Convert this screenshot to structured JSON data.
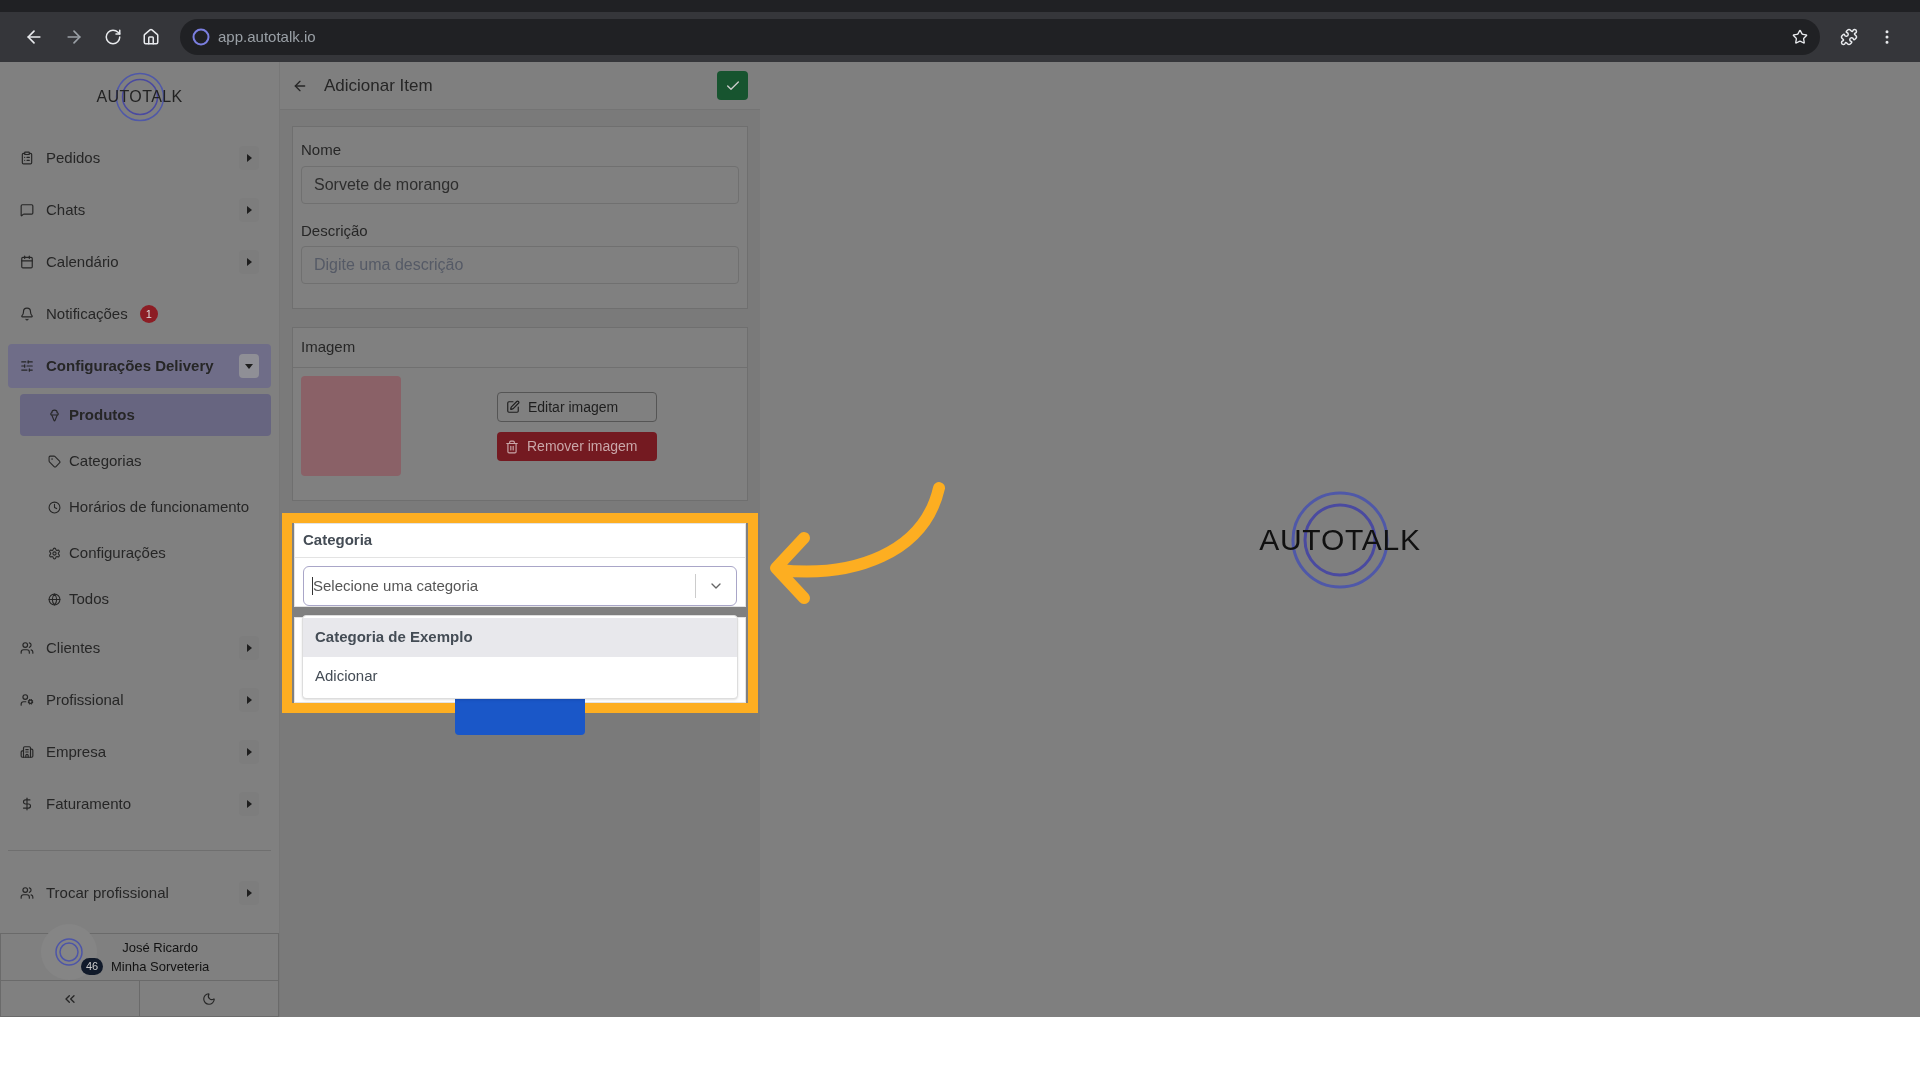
{
  "browser": {
    "url": "app.autotalk.io"
  },
  "sidebar": {
    "logo": "AUTOTALK",
    "items": [
      {
        "label": "Pedidos",
        "kind": "menu",
        "expanded": false
      },
      {
        "label": "Chats",
        "kind": "menu",
        "expanded": false
      },
      {
        "label": "Calendário",
        "kind": "menu",
        "expanded": false
      },
      {
        "label": "Notificações",
        "kind": "link",
        "badge": "1"
      },
      {
        "label": "Configurações Delivery",
        "kind": "menu",
        "expanded": true,
        "children": [
          {
            "label": "Produtos",
            "selected": true
          },
          {
            "label": "Categorias",
            "selected": false
          },
          {
            "label": "Horários de funcionamento",
            "selected": false
          },
          {
            "label": "Configurações",
            "selected": false
          },
          {
            "label": "Todos",
            "selected": false
          }
        ]
      },
      {
        "label": "Clientes",
        "kind": "menu",
        "expanded": false
      },
      {
        "label": "Profissional",
        "kind": "menu",
        "expanded": false
      },
      {
        "label": "Empresa",
        "kind": "menu",
        "expanded": false
      },
      {
        "label": "Faturamento",
        "kind": "menu",
        "expanded": false
      }
    ],
    "switch_item": {
      "label": "Trocar profissional"
    },
    "user": {
      "name": "José Ricardo",
      "company": "Minha Sorveteria",
      "badge": "46"
    }
  },
  "form": {
    "title": "Adicionar Item",
    "fields": [
      {
        "label": "Nome",
        "value": "Sorvete de morango"
      },
      {
        "label": "Descrição",
        "placeholder": "Digite uma descrição"
      }
    ],
    "image": {
      "title": "Imagem",
      "edit_button": "Editar imagem",
      "remove_button": "Remover imagem"
    },
    "category": {
      "title": "Categoria",
      "placeholder": "Selecione uma categoria",
      "options": [
        {
          "label": "Categoria de Exemplo",
          "selected": true
        },
        {
          "label": "Adicionar",
          "selected": false
        }
      ]
    }
  },
  "main": {
    "logo": "AUTOTALK"
  }
}
